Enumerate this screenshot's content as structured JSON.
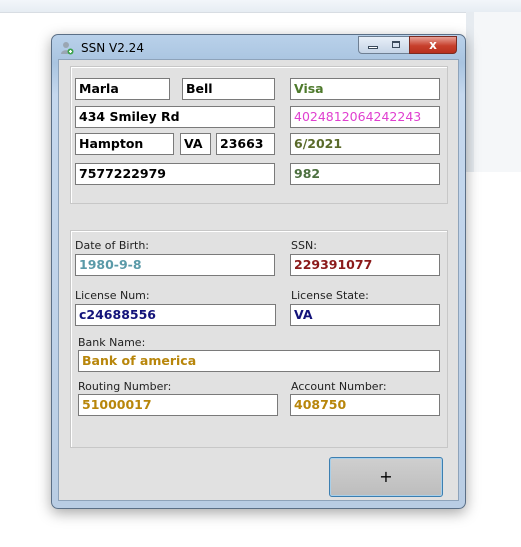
{
  "window": {
    "title": "SSN V2.24",
    "close_glyph": "x",
    "icon": "user-add-icon"
  },
  "card": {
    "first_name": "Marla",
    "last_name": "Bell",
    "card_type": "Visa",
    "street": "434 Smiley Rd",
    "card_number": "4024812064242243",
    "city": "Hampton",
    "state": "VA",
    "zip": "23663",
    "expiry": "6/2021",
    "phone": "7577222979",
    "cvv": "982"
  },
  "details": {
    "dob_label": "Date of Birth:",
    "dob": "1980-9-8",
    "ssn_label": "SSN:",
    "ssn": "229391077",
    "license_num_label": "License Num:",
    "license_num": "c24688556",
    "license_state_label": "License State:",
    "license_state": "VA",
    "bank_name_label": "Bank Name:",
    "bank_name": "Bank of america",
    "routing_label": "Routing Number:",
    "routing": "51000017",
    "account_label": "Account Number:",
    "account": "408750"
  },
  "actions": {
    "add_label": "+"
  },
  "colors": {
    "name_text": "#000000",
    "card_type": "#4e7a2c",
    "card_number": "#e040d0",
    "expiry": "#5a6a2a",
    "cvv": "#4d7040",
    "dob": "#5a9aa8",
    "ssn": "#8b1a1a",
    "license": "#13137a",
    "bank": "#b8860b"
  }
}
